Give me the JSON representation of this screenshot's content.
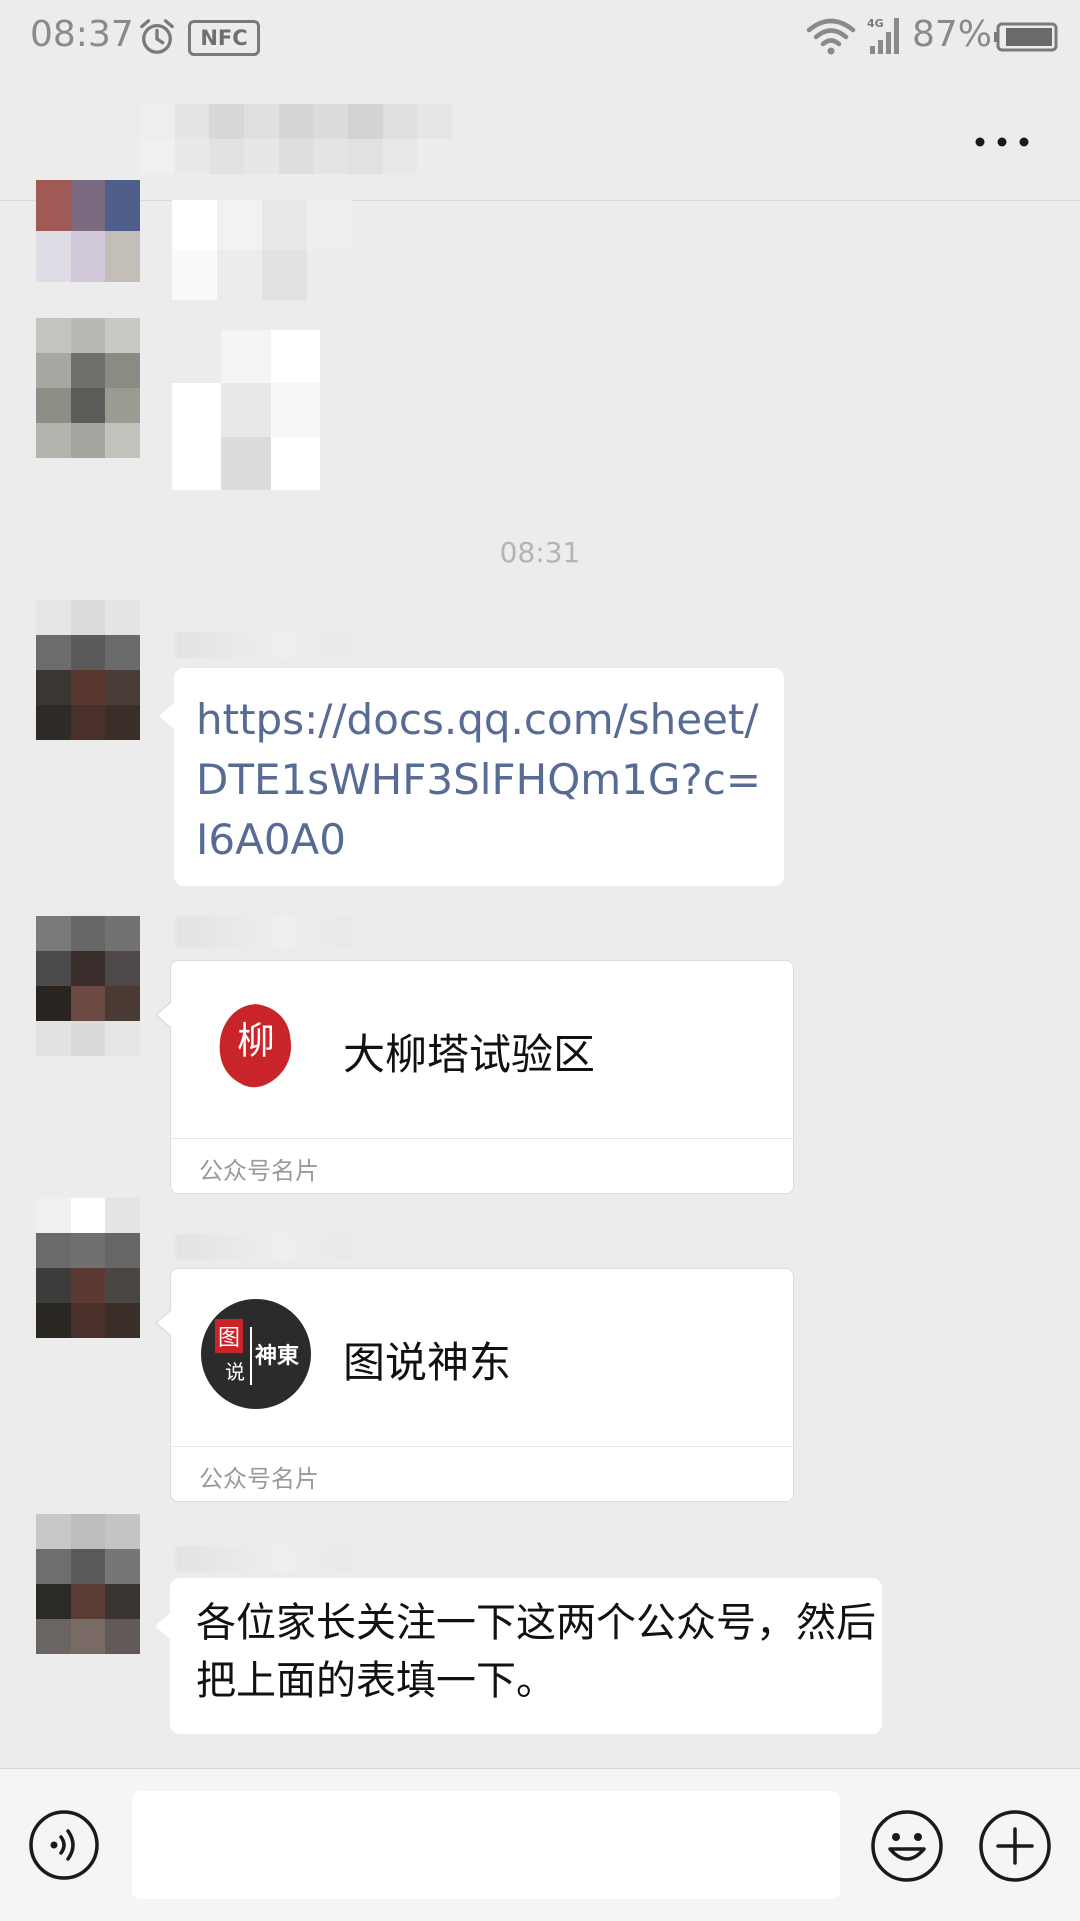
{
  "status_bar": {
    "time": "08:37",
    "nfc_label": "NFC",
    "network": "4G",
    "battery": "87%"
  },
  "icons": {
    "alarm": "alarm-clock-icon",
    "wifi": "wifi-icon",
    "signal": "cellular-signal-icon",
    "battery": "battery-icon",
    "more": "more-dots-icon",
    "voice": "voice-input-icon",
    "emoji": "emoji-icon",
    "plus": "plus-circle-icon"
  },
  "chat": {
    "timestamp": "08:31",
    "link_message": "https://docs.qq.com/sheet/DTE1sWHF3SlFHQm1G?c=I6A0A0",
    "cards": [
      {
        "name": "大柳塔试验区",
        "label": "公众号名片",
        "logo_text": "柳"
      },
      {
        "name": "图说神东",
        "label": "公众号名片",
        "logo_text_a": "图",
        "logo_text_b": "说",
        "logo_text_c": "神東"
      }
    ],
    "text_message": "各位家长关注一下这两个公众号，然后把上面的表填一下。"
  },
  "colors": {
    "background": "#ececec",
    "link": "#576b95",
    "bubble": "#ffffff",
    "card_logo_red": "#c8242a",
    "card_logo_dark": "#2b2b2b"
  }
}
